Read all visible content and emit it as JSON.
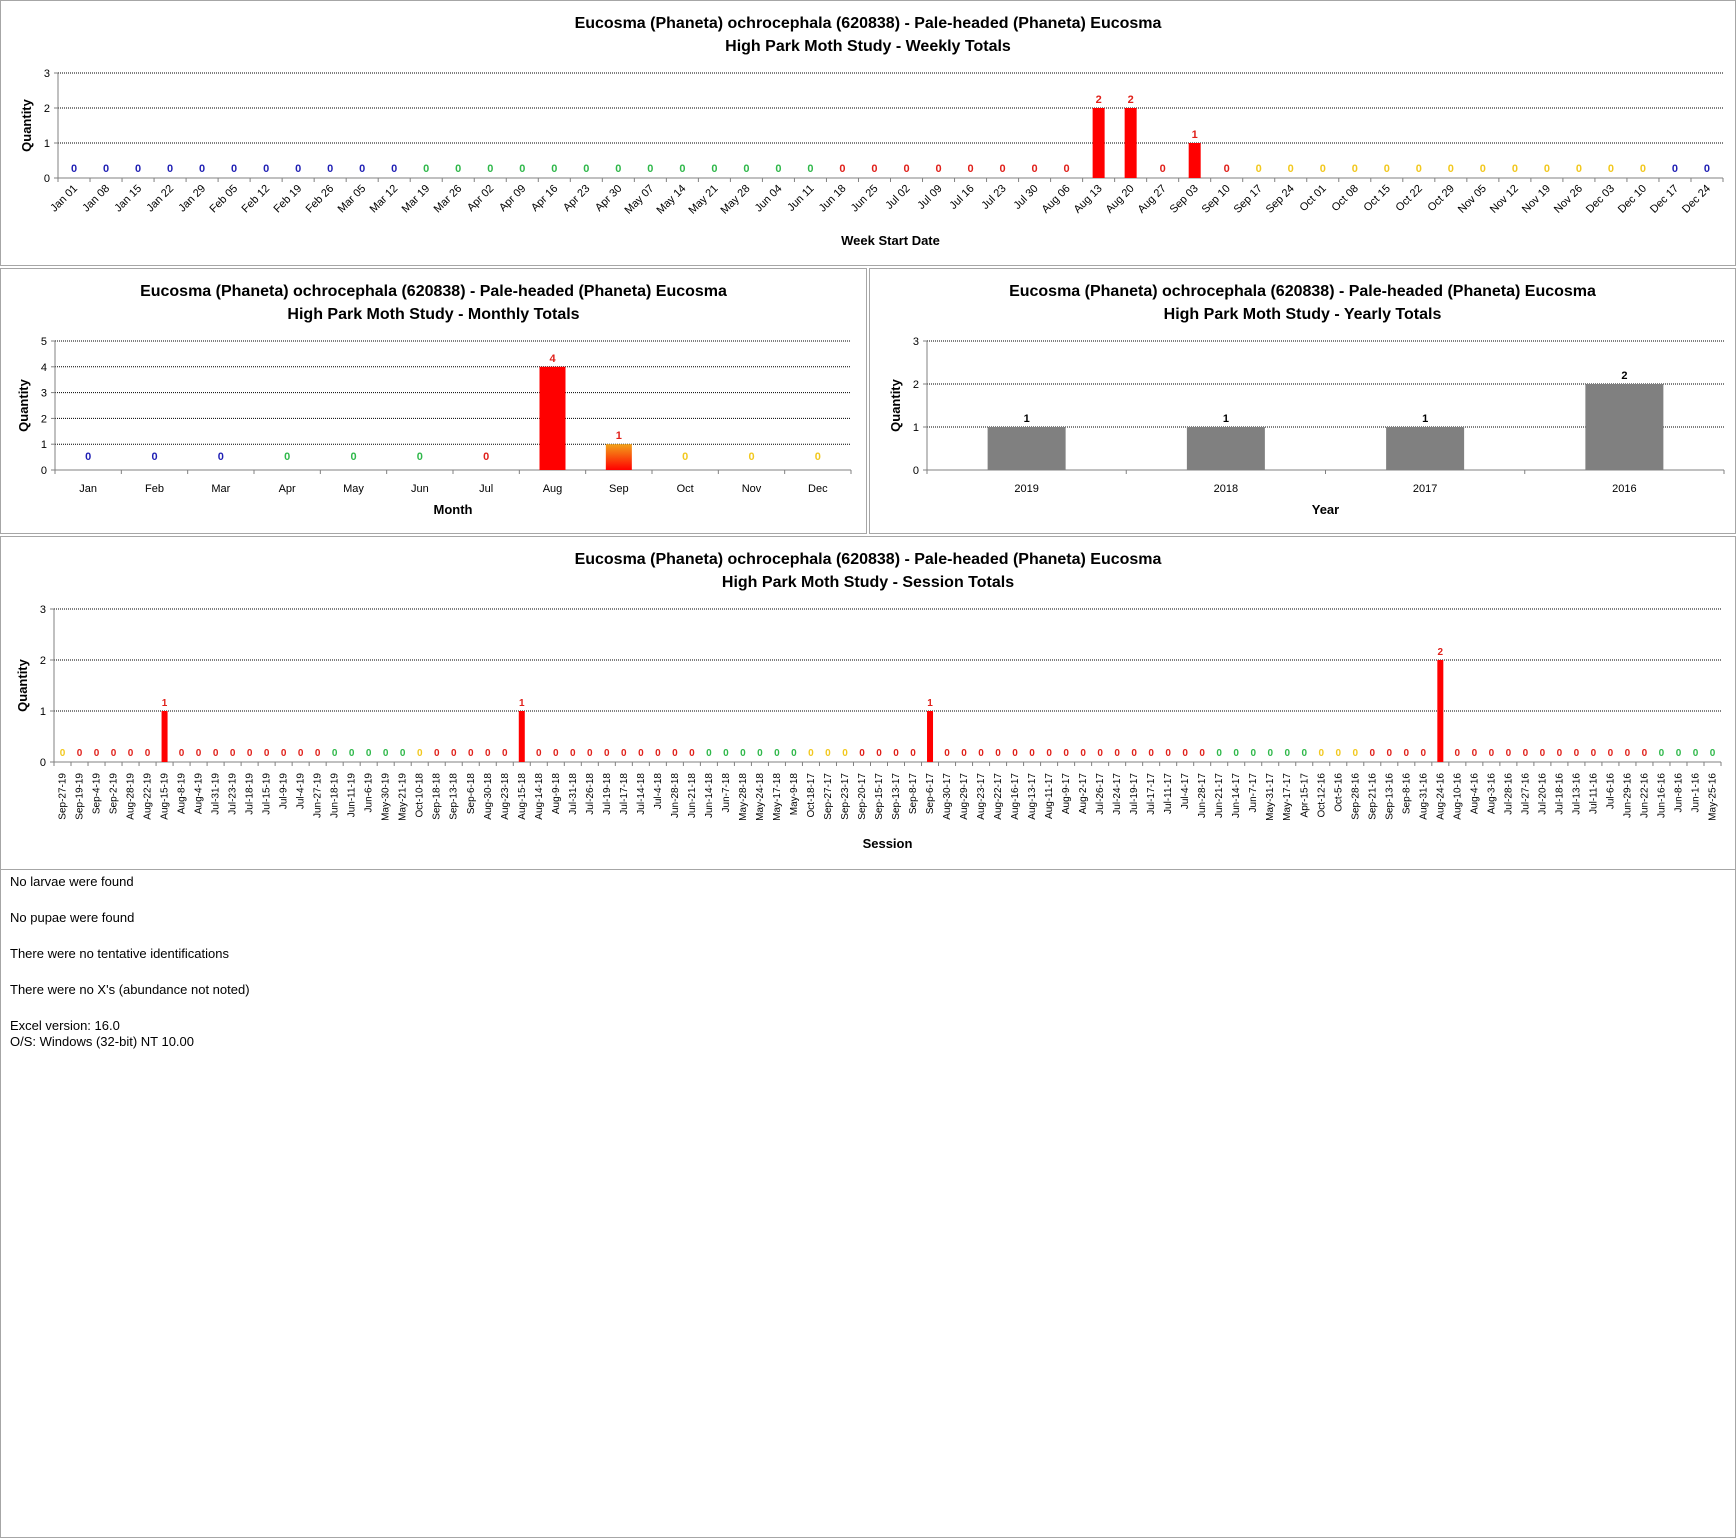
{
  "colors": {
    "blue": "#1f1fb4",
    "green": "#2fb84a",
    "red": "#e0201a",
    "orange": "#f2a21a",
    "yellow": "#f2c81e",
    "bar_red": "#ff0000",
    "bar_grey": "#808080",
    "grid": "#000000"
  },
  "chart_data": [
    {
      "id": "weekly",
      "type": "bar",
      "title": "Eucosma (Phaneta) ochrocephala (620838)  - Pale-headed (Phaneta) Eucosma",
      "subtitle": "High Park Moth Study  -  Weekly Totals",
      "xlabel": "Week Start Date",
      "ylabel": "Quantity",
      "ylim": [
        0,
        3
      ],
      "yticks": [
        0,
        1,
        2,
        3
      ],
      "grid": true,
      "categories": [
        "Jan 01",
        "Jan 08",
        "Jan 15",
        "Jan 22",
        "Jan 29",
        "Feb 05",
        "Feb 12",
        "Feb 19",
        "Feb 26",
        "Mar 05",
        "Mar 12",
        "Mar 19",
        "Mar 26",
        "Apr 02",
        "Apr 09",
        "Apr 16",
        "Apr 23",
        "Apr 30",
        "May 07",
        "May 14",
        "May 21",
        "May 28",
        "Jun 04",
        "Jun 11",
        "Jun 18",
        "Jun 25",
        "Jul 02",
        "Jul 09",
        "Jul 16",
        "Jul 23",
        "Jul 30",
        "Aug 06",
        "Aug 13",
        "Aug 20",
        "Aug 27",
        "Sep 03",
        "Sep 10",
        "Sep 17",
        "Sep 24",
        "Oct 01",
        "Oct 08",
        "Oct 15",
        "Oct 22",
        "Oct 29",
        "Nov 05",
        "Nov 12",
        "Nov 19",
        "Nov 26",
        "Dec 03",
        "Dec 10",
        "Dec 17",
        "Dec 24"
      ],
      "values": [
        0,
        0,
        0,
        0,
        0,
        0,
        0,
        0,
        0,
        0,
        0,
        0,
        0,
        0,
        0,
        0,
        0,
        0,
        0,
        0,
        0,
        0,
        0,
        0,
        0,
        0,
        0,
        0,
        0,
        0,
        0,
        0,
        2,
        2,
        0,
        1,
        0,
        0,
        0,
        0,
        0,
        0,
        0,
        0,
        0,
        0,
        0,
        0,
        0,
        0,
        0,
        0
      ],
      "label_colors": [
        "blue",
        "blue",
        "blue",
        "blue",
        "blue",
        "blue",
        "blue",
        "blue",
        "blue",
        "blue",
        "blue",
        "green",
        "green",
        "green",
        "green",
        "green",
        "green",
        "green",
        "green",
        "green",
        "green",
        "green",
        "green",
        "green",
        "red",
        "red",
        "red",
        "red",
        "red",
        "red",
        "red",
        "red",
        "red",
        "red",
        "red",
        "red",
        "red",
        "yellow",
        "yellow",
        "yellow",
        "yellow",
        "yellow",
        "yellow",
        "yellow",
        "yellow",
        "yellow",
        "yellow",
        "yellow",
        "yellow",
        "yellow",
        "blue",
        "blue"
      ]
    },
    {
      "id": "monthly",
      "type": "bar",
      "title": "Eucosma (Phaneta) ochrocephala (620838)  - Pale-headed (Phaneta) Eucosma",
      "subtitle": "High Park Moth Study  -  Monthly Totals",
      "xlabel": "Month",
      "ylabel": "Quantity",
      "ylim": [
        0,
        5
      ],
      "yticks": [
        0,
        1,
        2,
        3,
        4,
        5
      ],
      "grid": true,
      "categories": [
        "Jan",
        "Feb",
        "Mar",
        "Apr",
        "May",
        "Jun",
        "Jul",
        "Aug",
        "Sep",
        "Oct",
        "Nov",
        "Dec"
      ],
      "values": [
        0,
        0,
        0,
        0,
        0,
        0,
        0,
        4,
        1,
        0,
        0,
        0
      ],
      "label_colors": [
        "blue",
        "blue",
        "blue",
        "green",
        "green",
        "green",
        "red",
        "red",
        "red",
        "yellow",
        "yellow",
        "yellow"
      ],
      "bar_fills": [
        "red",
        "red",
        "red",
        "red",
        "red",
        "red",
        "red",
        "red",
        "gradient",
        "red",
        "red",
        "red"
      ]
    },
    {
      "id": "yearly",
      "type": "bar",
      "title": "Eucosma (Phaneta) ochrocephala (620838)  - Pale-headed (Phaneta) Eucosma",
      "subtitle": "High Park Moth Study  -  Yearly Totals",
      "xlabel": "Year",
      "ylabel": "Quantity",
      "ylim": [
        0,
        3
      ],
      "yticks": [
        0,
        1,
        2,
        3
      ],
      "grid": true,
      "categories": [
        "2019",
        "2018",
        "2017",
        "2016"
      ],
      "values": [
        1,
        1,
        1,
        2
      ]
    },
    {
      "id": "session",
      "type": "bar",
      "title": "Eucosma (Phaneta) ochrocephala (620838)  - Pale-headed (Phaneta) Eucosma",
      "subtitle": "High Park Moth Study  -  Session Totals",
      "xlabel": "Session",
      "ylabel": "Quantity",
      "ylim": [
        0,
        3
      ],
      "yticks": [
        0,
        1,
        2,
        3
      ],
      "grid": true,
      "categories": [
        "Sep-27-19",
        "Sep-19-19",
        "Sep-4-19",
        "Sep-2-19",
        "Aug-28-19",
        "Aug-22-19",
        "Aug-15-19",
        "Aug-8-19",
        "Aug-4-19",
        "Jul-31-19",
        "Jul-23-19",
        "Jul-18-19",
        "Jul-15-19",
        "Jul-9-19",
        "Jul-4-19",
        "Jun-27-19",
        "Jun-18-19",
        "Jun-11-19",
        "Jun-6-19",
        "May-30-19",
        "May-21-19",
        "Oct-10-18",
        "Sep-18-18",
        "Sep-13-18",
        "Sep-6-18",
        "Aug-30-18",
        "Aug-23-18",
        "Aug-15-18",
        "Aug-14-18",
        "Aug-9-18",
        "Jul-31-18",
        "Jul-26-18",
        "Jul-19-18",
        "Jul-17-18",
        "Jul-14-18",
        "Jul-4-18",
        "Jun-28-18",
        "Jun-21-18",
        "Jun-14-18",
        "Jun-7-18",
        "May-28-18",
        "May-24-18",
        "May-17-18",
        "May-9-18",
        "Oct-18-17",
        "Sep-27-17",
        "Sep-23-17",
        "Sep-20-17",
        "Sep-15-17",
        "Sep-13-17",
        "Sep-8-17",
        "Sep-6-17",
        "Aug-30-17",
        "Aug-29-17",
        "Aug-23-17",
        "Aug-22-17",
        "Aug-16-17",
        "Aug-13-17",
        "Aug-11-17",
        "Aug-9-17",
        "Aug-2-17",
        "Jul-26-17",
        "Jul-24-17",
        "Jul-19-17",
        "Jul-17-17",
        "Jul-11-17",
        "Jul-4-17",
        "Jun-28-17",
        "Jun-21-17",
        "Jun-14-17",
        "Jun-7-17",
        "May-31-17",
        "May-17-17",
        "Apr-15-17",
        "Oct-12-16",
        "Oct-5-16",
        "Sep-28-16",
        "Sep-21-16",
        "Sep-13-16",
        "Sep-8-16",
        "Aug-31-16",
        "Aug-24-16",
        "Aug-10-16",
        "Aug-4-16",
        "Aug-3-16",
        "Jul-28-16",
        "Jul-27-16",
        "Jul-20-16",
        "Jul-18-16",
        "Jul-13-16",
        "Jul-11-16",
        "Jul-6-16",
        "Jun-29-16",
        "Jun-22-16",
        "Jun-16-16",
        "Jun-8-16",
        "Jun-1-16",
        "May-25-16"
      ],
      "values": [
        0,
        0,
        0,
        0,
        0,
        0,
        1,
        0,
        0,
        0,
        0,
        0,
        0,
        0,
        0,
        0,
        0,
        0,
        0,
        0,
        0,
        0,
        0,
        0,
        0,
        0,
        0,
        1,
        0,
        0,
        0,
        0,
        0,
        0,
        0,
        0,
        0,
        0,
        0,
        0,
        0,
        0,
        0,
        0,
        0,
        0,
        0,
        0,
        0,
        0,
        0,
        1,
        0,
        0,
        0,
        0,
        0,
        0,
        0,
        0,
        0,
        0,
        0,
        0,
        0,
        0,
        0,
        0,
        0,
        0,
        0,
        0,
        0,
        0,
        0,
        0,
        0,
        0,
        0,
        0,
        0,
        2,
        0,
        0,
        0,
        0,
        0,
        0,
        0,
        0,
        0,
        0,
        0,
        0,
        0,
        0,
        0,
        0
      ],
      "label_colors": [
        "yellow",
        "red",
        "red",
        "red",
        "red",
        "red",
        "red",
        "red",
        "red",
        "red",
        "red",
        "red",
        "red",
        "red",
        "red",
        "red",
        "green",
        "green",
        "green",
        "green",
        "green",
        "yellow",
        "red",
        "red",
        "red",
        "red",
        "red",
        "red",
        "red",
        "red",
        "red",
        "red",
        "red",
        "red",
        "red",
        "red",
        "red",
        "red",
        "green",
        "green",
        "green",
        "green",
        "green",
        "green",
        "yellow",
        "yellow",
        "yellow",
        "red",
        "red",
        "red",
        "red",
        "red",
        "red",
        "red",
        "red",
        "red",
        "red",
        "red",
        "red",
        "red",
        "red",
        "red",
        "red",
        "red",
        "red",
        "red",
        "red",
        "red",
        "green",
        "green",
        "green",
        "green",
        "green",
        "green",
        "yellow",
        "yellow",
        "yellow",
        "red",
        "red",
        "red",
        "red",
        "red",
        "red",
        "red",
        "red",
        "red",
        "red",
        "red",
        "red",
        "red",
        "red",
        "red",
        "red",
        "red",
        "green",
        "green",
        "green",
        "green"
      ]
    }
  ],
  "notes": {
    "larvae": "No larvae were found",
    "pupae": "No pupae were found",
    "tentative": "There were no tentative identifications",
    "xs": "There were no X's (abundance not noted)",
    "excel_version": "Excel version: 16.0",
    "os": "O/S: Windows (32-bit) NT 10.00"
  }
}
